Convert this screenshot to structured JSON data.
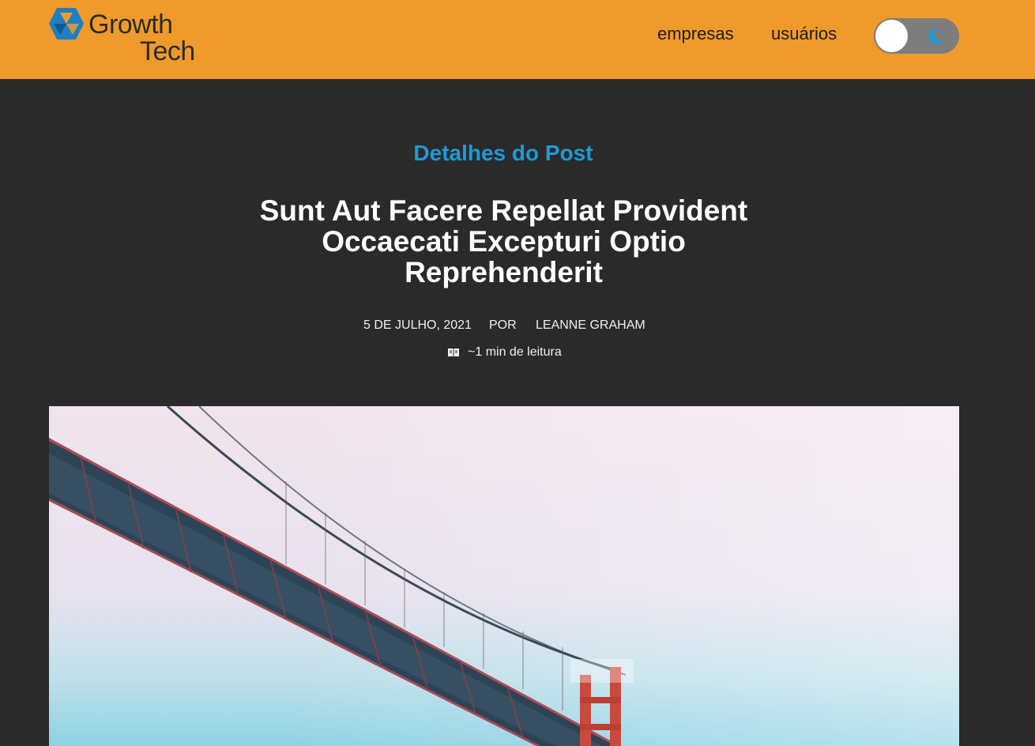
{
  "header": {
    "logo_line1": "Growth",
    "logo_line2": "Tech",
    "nav": [
      "empresas",
      "usuários"
    ],
    "theme_toggle_icon": "moon-icon",
    "colors": {
      "header_bg": "#f09a2b",
      "logo_blue": "#1e7fc2"
    }
  },
  "main": {
    "page_heading": "Detalhes do Post",
    "post": {
      "title": "Sunt Aut Facere Repellat Provident Occaecati Excepturi Optio Reprehenderit",
      "date": "5 DE JULHO, 2021",
      "by": "POR",
      "author": "LEANNE GRAHAM",
      "reading_icon": "book-icon",
      "reading_time": "~1 min de leitura"
    }
  },
  "colors": {
    "page_bg": "#2a2a2a",
    "accent": "#1e9ad6"
  }
}
